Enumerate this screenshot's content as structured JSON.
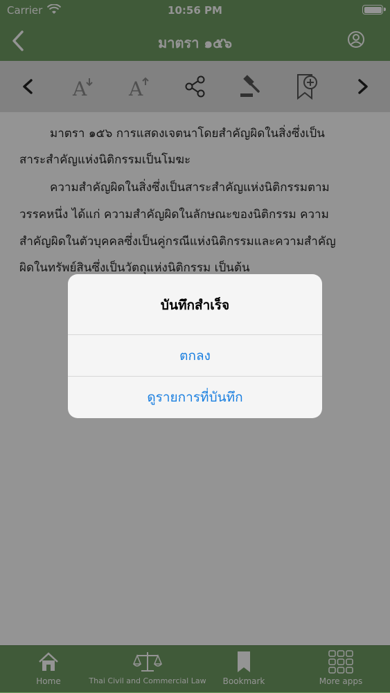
{
  "status": {
    "carrier": "Carrier",
    "time": "10:56 PM"
  },
  "nav": {
    "title": "มาตรา ๑๕๖"
  },
  "content": {
    "para1_line1": "มาตรา ๑๕๖  การแสดงเจตนาโดยสำคัญผิดในสิ่งซึ่งเป็น",
    "para1_line2": "สาระสำคัญแห่งนิติกรรมเป็นโมฆะ",
    "para2_line1": "ความสำคัญผิดในสิ่งซึ่งเป็นสาระสำคัญแห่งนิติกรรมตาม",
    "para2_line2": "วรรคหนึ่ง ได้แก่ ความสำคัญผิดในลักษณะของนิติกรรม  ความ",
    "para2_line3": "สำคัญผิดในตัวบุคคลซึ่งเป็นคู่กรณีแห่งนิติกรรมและความสำคัญ",
    "para2_line4": "ผิดในทรัพย์สินซึ่งเป็นวัตถุแห่งนิติกรรม เป็นต้น"
  },
  "alert": {
    "title": "บันทึกสำเร็จ",
    "ok_label": "ตกลง",
    "view_label": "ดูรายการที่บันทึก"
  },
  "tabs": [
    {
      "label": "Home",
      "icon": "home-icon"
    },
    {
      "label": "Thai Civil and Commercial Law",
      "icon": "scales-icon"
    },
    {
      "label": "Bookmark",
      "icon": "bookmark-icon"
    },
    {
      "label": "More apps",
      "icon": "grid-icon"
    }
  ],
  "colors": {
    "brand": "#6f9c62",
    "alert_button": "#1a7fe0"
  }
}
